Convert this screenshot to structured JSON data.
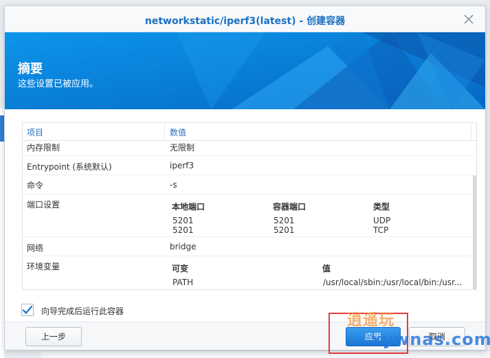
{
  "window": {
    "title": "networkstatic/iperf3(latest) - 创建容器"
  },
  "banner": {
    "title": "摘要",
    "subtitle": "这些设置已被应用。"
  },
  "table": {
    "headers": [
      "项目",
      "数值"
    ],
    "rows": {
      "memory": {
        "key": "内存限制",
        "value": "无限制"
      },
      "entrypoint": {
        "key": "Entrypoint (系统默认)",
        "value": "iperf3"
      },
      "command": {
        "key": "命令",
        "value": "-s"
      },
      "ports": {
        "key": "端口设置",
        "columns": [
          "本地端口",
          "容器端口",
          "类型"
        ],
        "entries": [
          {
            "local": "5201",
            "container": "5201",
            "type": "UDP"
          },
          {
            "local": "5201",
            "container": "5201",
            "type": "TCP"
          }
        ]
      },
      "network": {
        "key": "网络",
        "value": "bridge"
      },
      "env": {
        "key": "环境变量",
        "columns": [
          "可变",
          "值"
        ],
        "entries": [
          {
            "name": "PATH",
            "value": "/usr/local/sbin:/usr/local/bin:/usr..."
          }
        ]
      }
    }
  },
  "checkbox": {
    "label": "向导完成后运行此容器",
    "checked": true
  },
  "buttons": {
    "prev": "上一步",
    "apply": "应用",
    "cancel": "取消"
  },
  "watermark": {
    "top": "逍遥玩",
    "bottom": "xywnas.com"
  },
  "colors": {
    "accent": "#1b6fc2",
    "banner": "#0a8ee6",
    "highlight": "#e23b3b"
  },
  "icons": {
    "close": "close-icon",
    "check": "checkmark-icon"
  }
}
